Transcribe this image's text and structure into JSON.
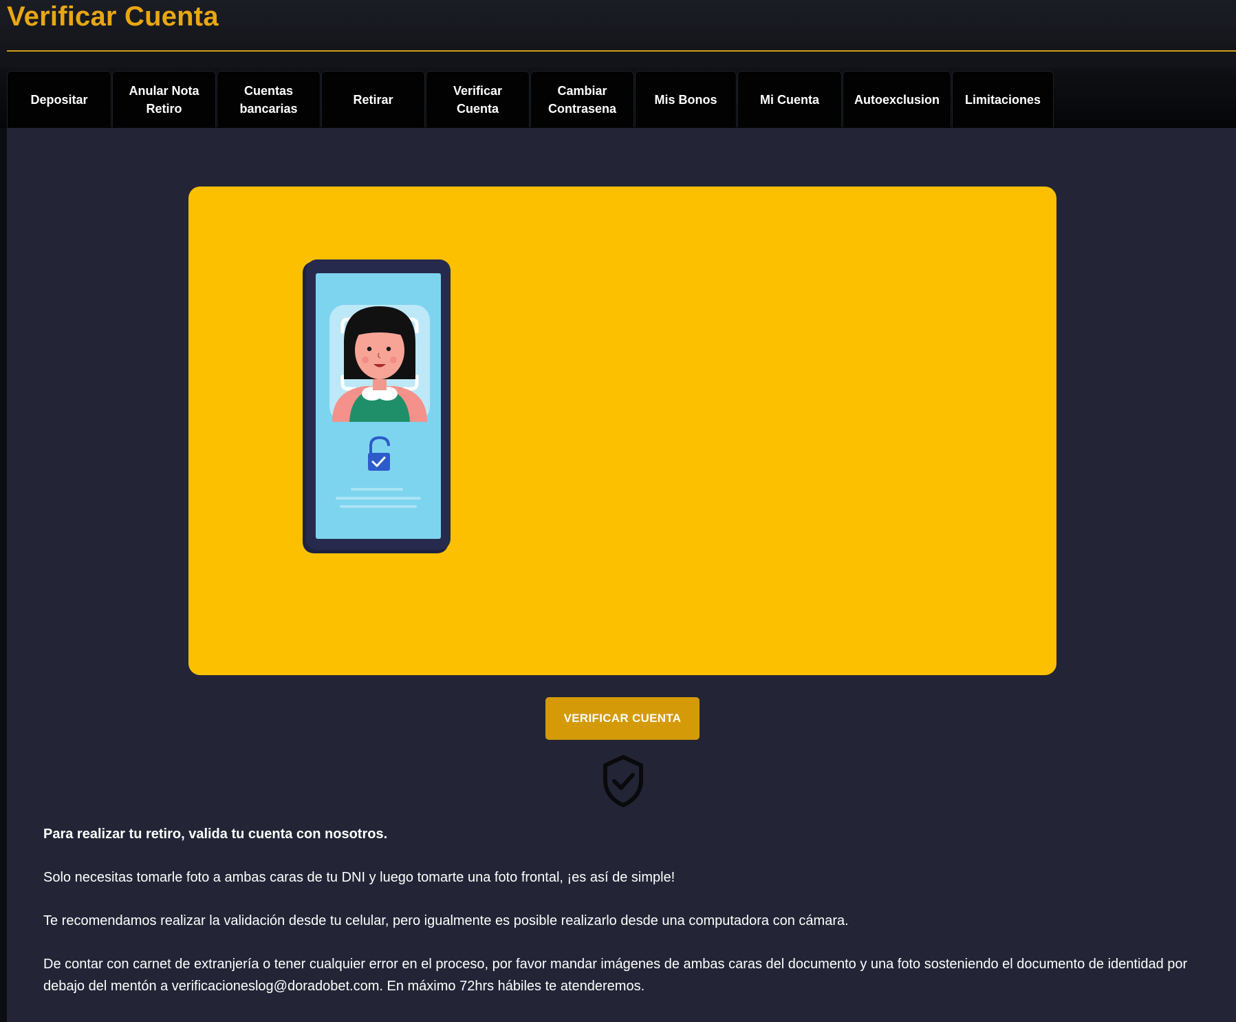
{
  "page": {
    "title": "Verificar Cuenta"
  },
  "tabs": [
    {
      "label": "Depositar"
    },
    {
      "label": "Anular Nota Retiro"
    },
    {
      "label": "Cuentas bancarias"
    },
    {
      "label": "Retirar"
    },
    {
      "label": "Verificar Cuenta"
    },
    {
      "label": "Cambiar Contrasena"
    },
    {
      "label": "Mis Bonos"
    },
    {
      "label": "Mi Cuenta"
    },
    {
      "label": "Autoexclusion"
    },
    {
      "label": "Limitaciones"
    }
  ],
  "hero": {
    "illustration": "phone-face-verification-illustration"
  },
  "action": {
    "verify_label": "VERIFICAR CUENTA",
    "shield_icon": "shield-check-icon"
  },
  "info": {
    "lead": "Para realizar tu retiro, valida tu cuenta con nosotros.",
    "p1": "Solo necesitas tomarle foto a ambas caras de tu DNI y luego tomarte una foto frontal, ¡es así de simple!",
    "p2": "Te recomendamos realizar la validación desde tu celular, pero igualmente es posible realizarlo desde una computadora con cámara.",
    "p3": "De contar con carnet de extranjería o tener cualquier error en el proceso, por favor mandar imágenes de ambas caras del documento y una foto sosteniendo el documento de identidad por debajo del mentón a verificacioneslog@doradobet.com. En máximo 72hrs hábiles te atenderemos."
  },
  "colors": {
    "accent": "#e9a712",
    "hero_bg": "#fdc000",
    "button_bg": "#d49a08",
    "content_bg": "#232536",
    "tab_bg": "#020203"
  }
}
